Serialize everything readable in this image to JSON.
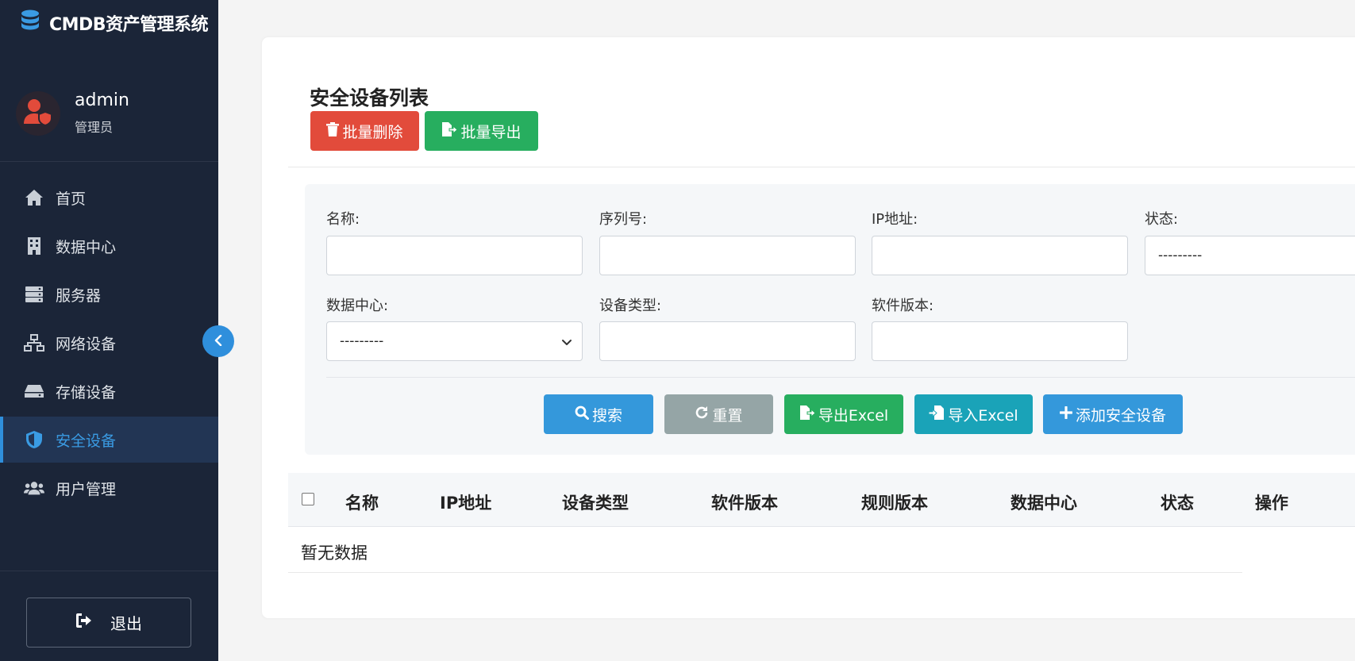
{
  "app": {
    "title": "CMDB资产管理系统",
    "brand_icon": "database-icon"
  },
  "user": {
    "name": "admin",
    "role": "管理员"
  },
  "sidebar": {
    "items": [
      {
        "label": "首页",
        "icon": "home-icon"
      },
      {
        "label": "数据中心",
        "icon": "building-icon"
      },
      {
        "label": "服务器",
        "icon": "server-icon"
      },
      {
        "label": "网络设备",
        "icon": "network-icon"
      },
      {
        "label": "存储设备",
        "icon": "hdd-icon"
      },
      {
        "label": "安全设备",
        "icon": "shield-icon",
        "active": true
      },
      {
        "label": "用户管理",
        "icon": "users-icon"
      }
    ],
    "logout_label": "退出"
  },
  "page": {
    "title": "安全设备列表",
    "bulk_delete_label": "批量删除",
    "bulk_export_label": "批量导出"
  },
  "filters": {
    "name_label": "名称:",
    "serial_label": "序列号:",
    "ip_label": "IP地址:",
    "status_label": "状态:",
    "status_value": "---------",
    "datacenter_label": "数据中心:",
    "datacenter_value": "---------",
    "device_type_label": "设备类型:",
    "software_version_label": "软件版本:"
  },
  "actions": {
    "search_label": "搜索",
    "reset_label": "重置",
    "export_excel_label": "导出Excel",
    "import_excel_label": "导入Excel",
    "add_label": "添加安全设备"
  },
  "table": {
    "columns": [
      "名称",
      "IP地址",
      "设备类型",
      "软件版本",
      "规则版本",
      "数据中心",
      "状态",
      "操作"
    ],
    "empty_text": "暂无数据"
  },
  "colors": {
    "sidebar_bg": "#1b2538",
    "active_accent": "#2f8fdc",
    "danger": "#e24b3b",
    "success": "#27ae5f",
    "primary": "#3498db",
    "secondary": "#95a5a6",
    "info": "#1aa3b8"
  }
}
